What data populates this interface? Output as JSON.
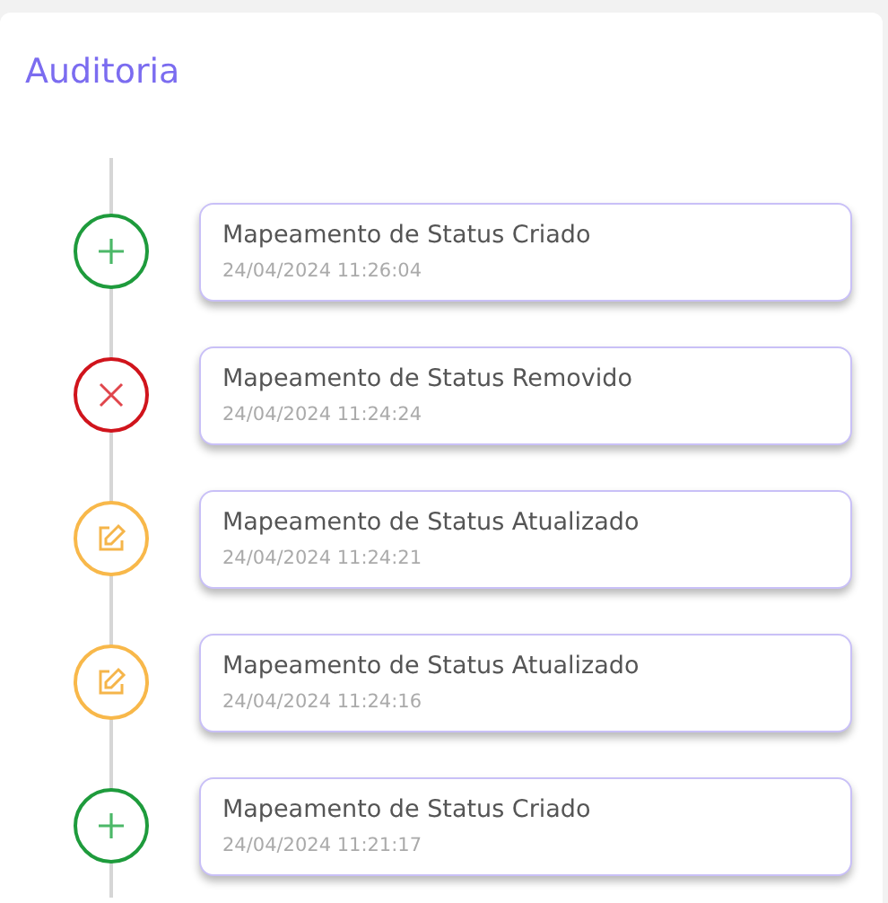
{
  "title": "Auditoria",
  "events": [
    {
      "kind": "created",
      "title": "Mapeamento de Status Criado",
      "timestamp": "24/04/2024 11:26:04"
    },
    {
      "kind": "removed",
      "title": "Mapeamento de Status Removido",
      "timestamp": "24/04/2024 11:24:24"
    },
    {
      "kind": "updated",
      "title": "Mapeamento de Status Atualizado",
      "timestamp": "24/04/2024 11:24:21"
    },
    {
      "kind": "updated",
      "title": "Mapeamento de Status Atualizado",
      "timestamp": "24/04/2024 11:24:16"
    },
    {
      "kind": "created",
      "title": "Mapeamento de Status Criado",
      "timestamp": "24/04/2024 11:21:17"
    }
  ]
}
